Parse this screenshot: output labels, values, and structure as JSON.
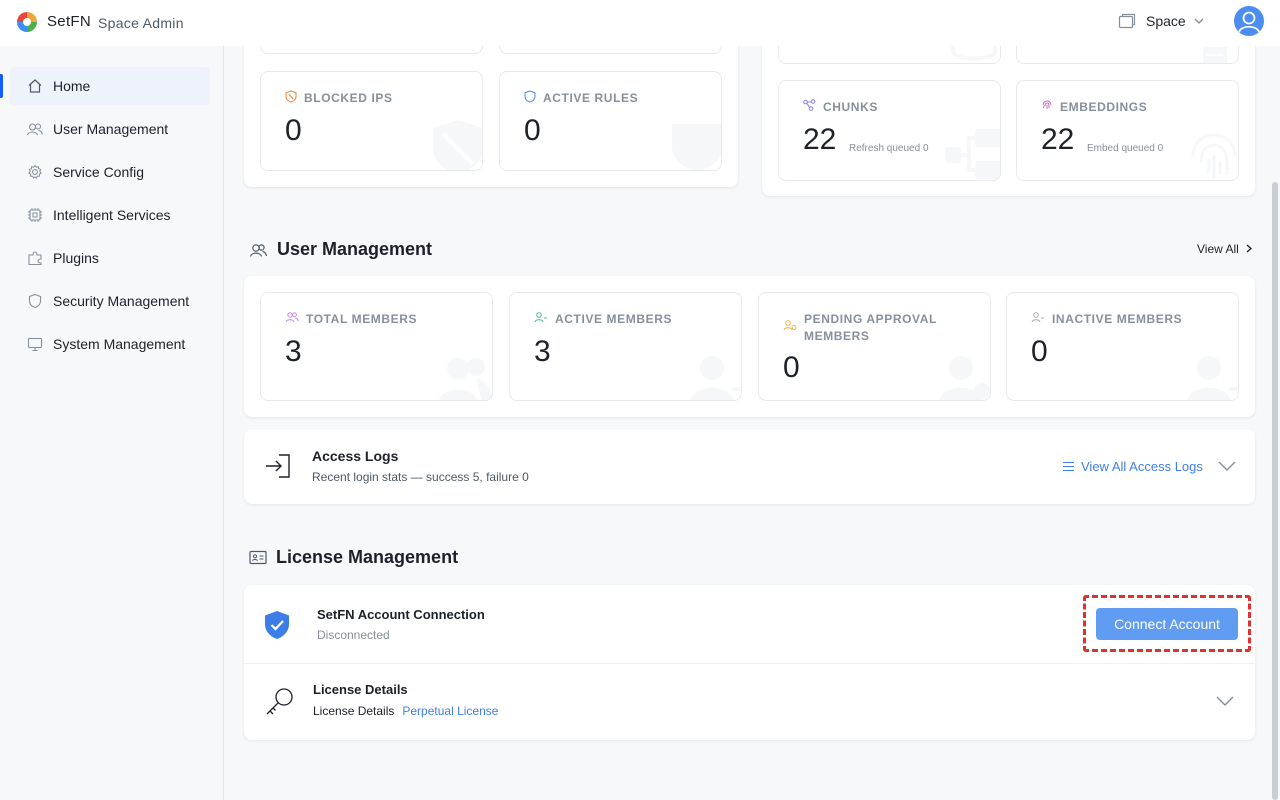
{
  "header": {
    "brand": "SetFN",
    "subtitle": "Space Admin",
    "space_label": "Space"
  },
  "sidebar": {
    "items": [
      {
        "label": "Home",
        "icon": "home-icon"
      },
      {
        "label": "User Management",
        "icon": "users-icon"
      },
      {
        "label": "Service Config",
        "icon": "gear-icon"
      },
      {
        "label": "Intelligent Services",
        "icon": "chip-icon"
      },
      {
        "label": "Plugins",
        "icon": "puzzle-icon"
      },
      {
        "label": "Security Management",
        "icon": "shield-icon"
      },
      {
        "label": "System Management",
        "icon": "monitor-icon"
      }
    ]
  },
  "security": {
    "blocked_ips": {
      "label": "BLOCKED IPS",
      "value": "0"
    },
    "active_rules": {
      "label": "ACTIVE RULES",
      "value": "0"
    }
  },
  "knowledge": {
    "chunks": {
      "label": "CHUNKS",
      "value": "22",
      "sub": "Refresh queued 0"
    },
    "embeddings": {
      "label": "EMBEDDINGS",
      "value": "22",
      "sub": "Embed queued 0"
    }
  },
  "user_management": {
    "title": "User Management",
    "view_all": "View All",
    "cards": [
      {
        "label": "TOTAL MEMBERS",
        "value": "3",
        "color": "#c88be6"
      },
      {
        "label": "ACTIVE MEMBERS",
        "value": "3",
        "color": "#4cbf8a"
      },
      {
        "label": "PENDING APPROVAL MEMBERS",
        "value": "0",
        "color": "#f2b33d"
      },
      {
        "label": "INACTIVE MEMBERS",
        "value": "0",
        "color": "#a9aeb8"
      }
    ]
  },
  "access_logs": {
    "title": "Access Logs",
    "subtitle": "Recent login stats — success 5, failure 0",
    "link": "View All Access Logs"
  },
  "license": {
    "title": "License Management",
    "connection_title": "SetFN Account Connection",
    "connection_status": "Disconnected",
    "connect_button": "Connect Account",
    "details_title": "License Details",
    "details_label": "License Details",
    "details_value": "Perpetual License"
  },
  "colors": {
    "accent": "#165dff",
    "button": "#5f9cf2",
    "link": "#3f7fe6",
    "highlight": "#e03131"
  }
}
